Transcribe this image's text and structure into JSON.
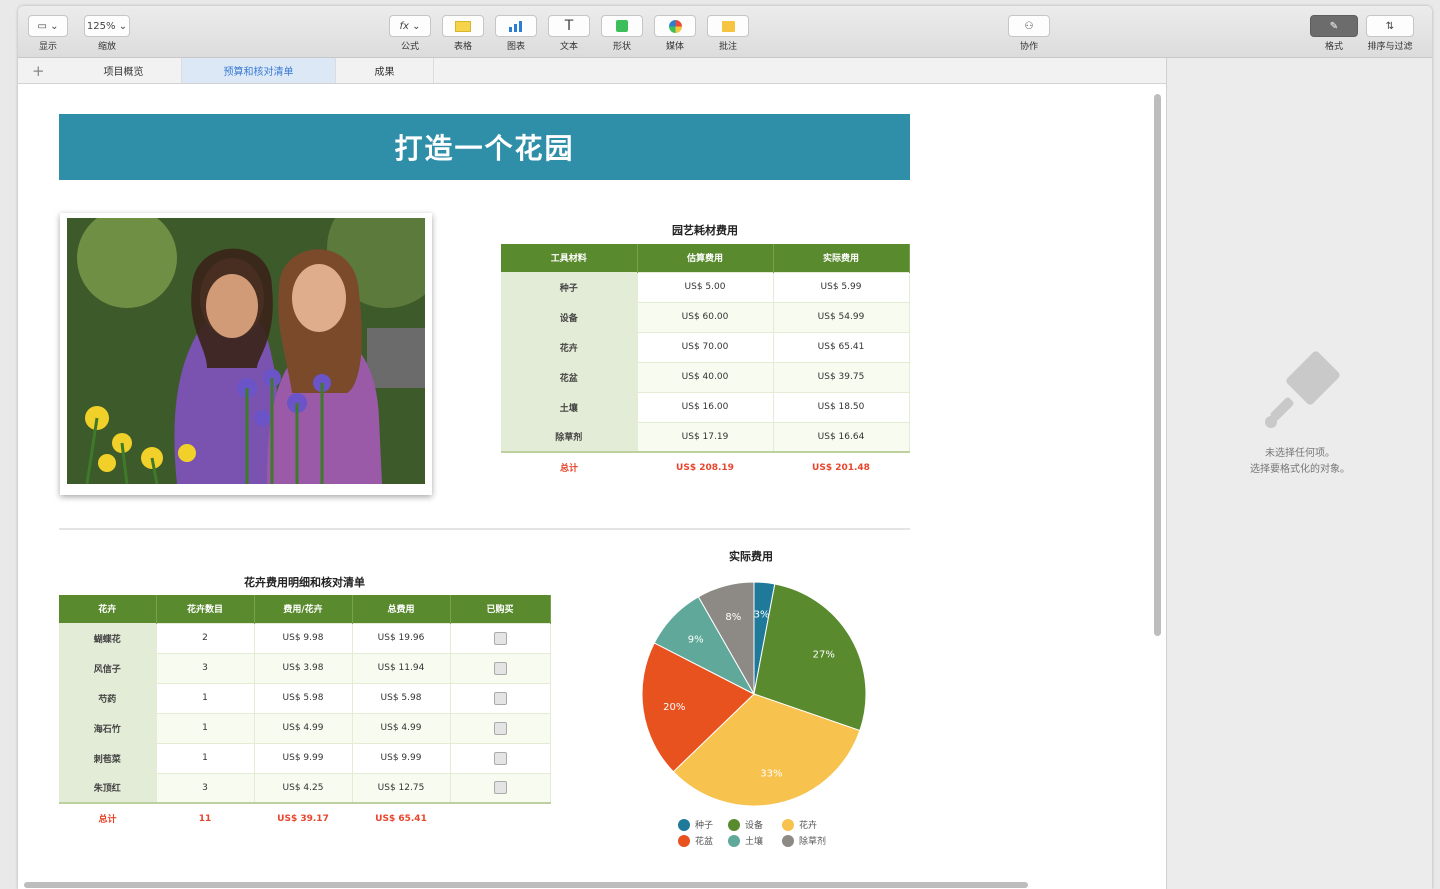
{
  "toolbar": {
    "view_label": "显示",
    "zoom_value": "125%",
    "zoom_label": "缩放",
    "formula_label": "公式",
    "table_label": "表格",
    "chart_label": "图表",
    "text_label": "文本",
    "shape_label": "形状",
    "media_label": "媒体",
    "comment_label": "批注",
    "collaborate_label": "协作",
    "format_label": "格式",
    "organize_label": "排序与过滤"
  },
  "tabs": [
    {
      "label": "项目概览"
    },
    {
      "label": "预算和核对清单"
    },
    {
      "label": "成果"
    }
  ],
  "banner": {
    "title": "打造一个花园"
  },
  "supplies_table": {
    "title": "园艺耗材费用",
    "headers": [
      "工具材料",
      "估算费用",
      "实际费用"
    ],
    "rows": [
      [
        "种子",
        "US$ 5.00",
        "US$ 5.99"
      ],
      [
        "设备",
        "US$ 60.00",
        "US$ 54.99"
      ],
      [
        "花卉",
        "US$ 70.00",
        "US$ 65.41"
      ],
      [
        "花盆",
        "US$ 40.00",
        "US$ 39.75"
      ],
      [
        "土壤",
        "US$ 16.00",
        "US$ 18.50"
      ],
      [
        "除草剂",
        "US$ 17.19",
        "US$ 16.64"
      ]
    ],
    "total": [
      "总计",
      "US$ 208.19",
      "US$ 201.48"
    ]
  },
  "flowers_table": {
    "title": "花卉费用明细和核对清单",
    "headers": [
      "花卉",
      "花卉数目",
      "费用/花卉",
      "总费用",
      "已购买"
    ],
    "rows": [
      [
        "蝴蝶花",
        "2",
        "US$ 9.98",
        "US$ 19.96"
      ],
      [
        "风信子",
        "3",
        "US$ 3.98",
        "US$ 11.94"
      ],
      [
        "芍药",
        "1",
        "US$ 5.98",
        "US$ 5.98"
      ],
      [
        "海石竹",
        "1",
        "US$ 4.99",
        "US$ 4.99"
      ],
      [
        "刺苞菜",
        "1",
        "US$ 9.99",
        "US$ 9.99"
      ],
      [
        "朱顶红",
        "3",
        "US$ 4.25",
        "US$ 12.75"
      ]
    ],
    "total": [
      "总计",
      "11",
      "US$ 39.17",
      "US$ 65.41"
    ]
  },
  "inspector": {
    "line1": "未选择任何项。",
    "line2": "选择要格式化的对象。"
  },
  "chart_data": {
    "type": "pie",
    "title": "实际费用",
    "categories": [
      "种子",
      "设备",
      "花卉",
      "花盆",
      "土壤",
      "除草剂"
    ],
    "values": [
      5.99,
      54.99,
      65.41,
      39.75,
      18.5,
      16.64
    ],
    "labels": [
      "3%",
      "27%",
      "33%",
      "20%",
      "9%",
      "8%"
    ],
    "colors": [
      "#1f7a9a",
      "#5a8a2e",
      "#f7c24e",
      "#e8521f",
      "#5fa89a",
      "#8d8a85"
    ],
    "legend_position": "bottom"
  }
}
